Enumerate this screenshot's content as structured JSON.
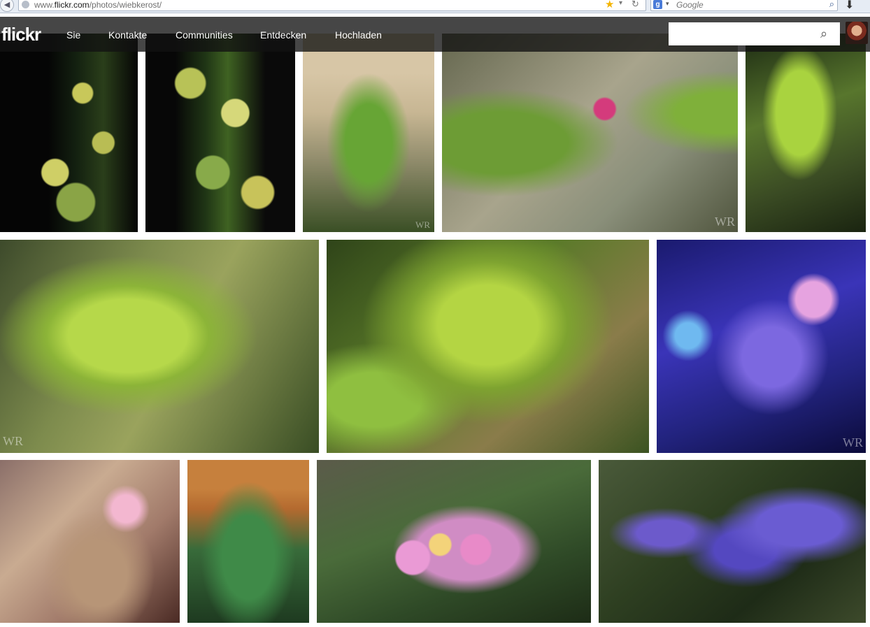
{
  "browser": {
    "url_prefix": "www.",
    "url_domain": "flickr.com",
    "url_path": "/photos/wiebkerost/",
    "search_engine_badge": "g",
    "search_placeholder": "Google",
    "icons": [
      "back-icon",
      "globe-icon",
      "star-icon",
      "dropdown-icon",
      "reload-icon",
      "search-icon",
      "download-icon"
    ]
  },
  "flickr": {
    "logo": "flickr",
    "nav": {
      "sie": "Sie",
      "kontakte": "Kontakte",
      "communities": "Communities",
      "entdecken": "Entdecken",
      "hochladen": "Hochladen"
    },
    "search": {
      "value": "",
      "placeholder": ""
    }
  },
  "photos": {
    "watermark": "WR"
  },
  "colors": {
    "nav_bg": "#121212",
    "grid_gap": "#ffffff",
    "star": "#f4b400"
  }
}
